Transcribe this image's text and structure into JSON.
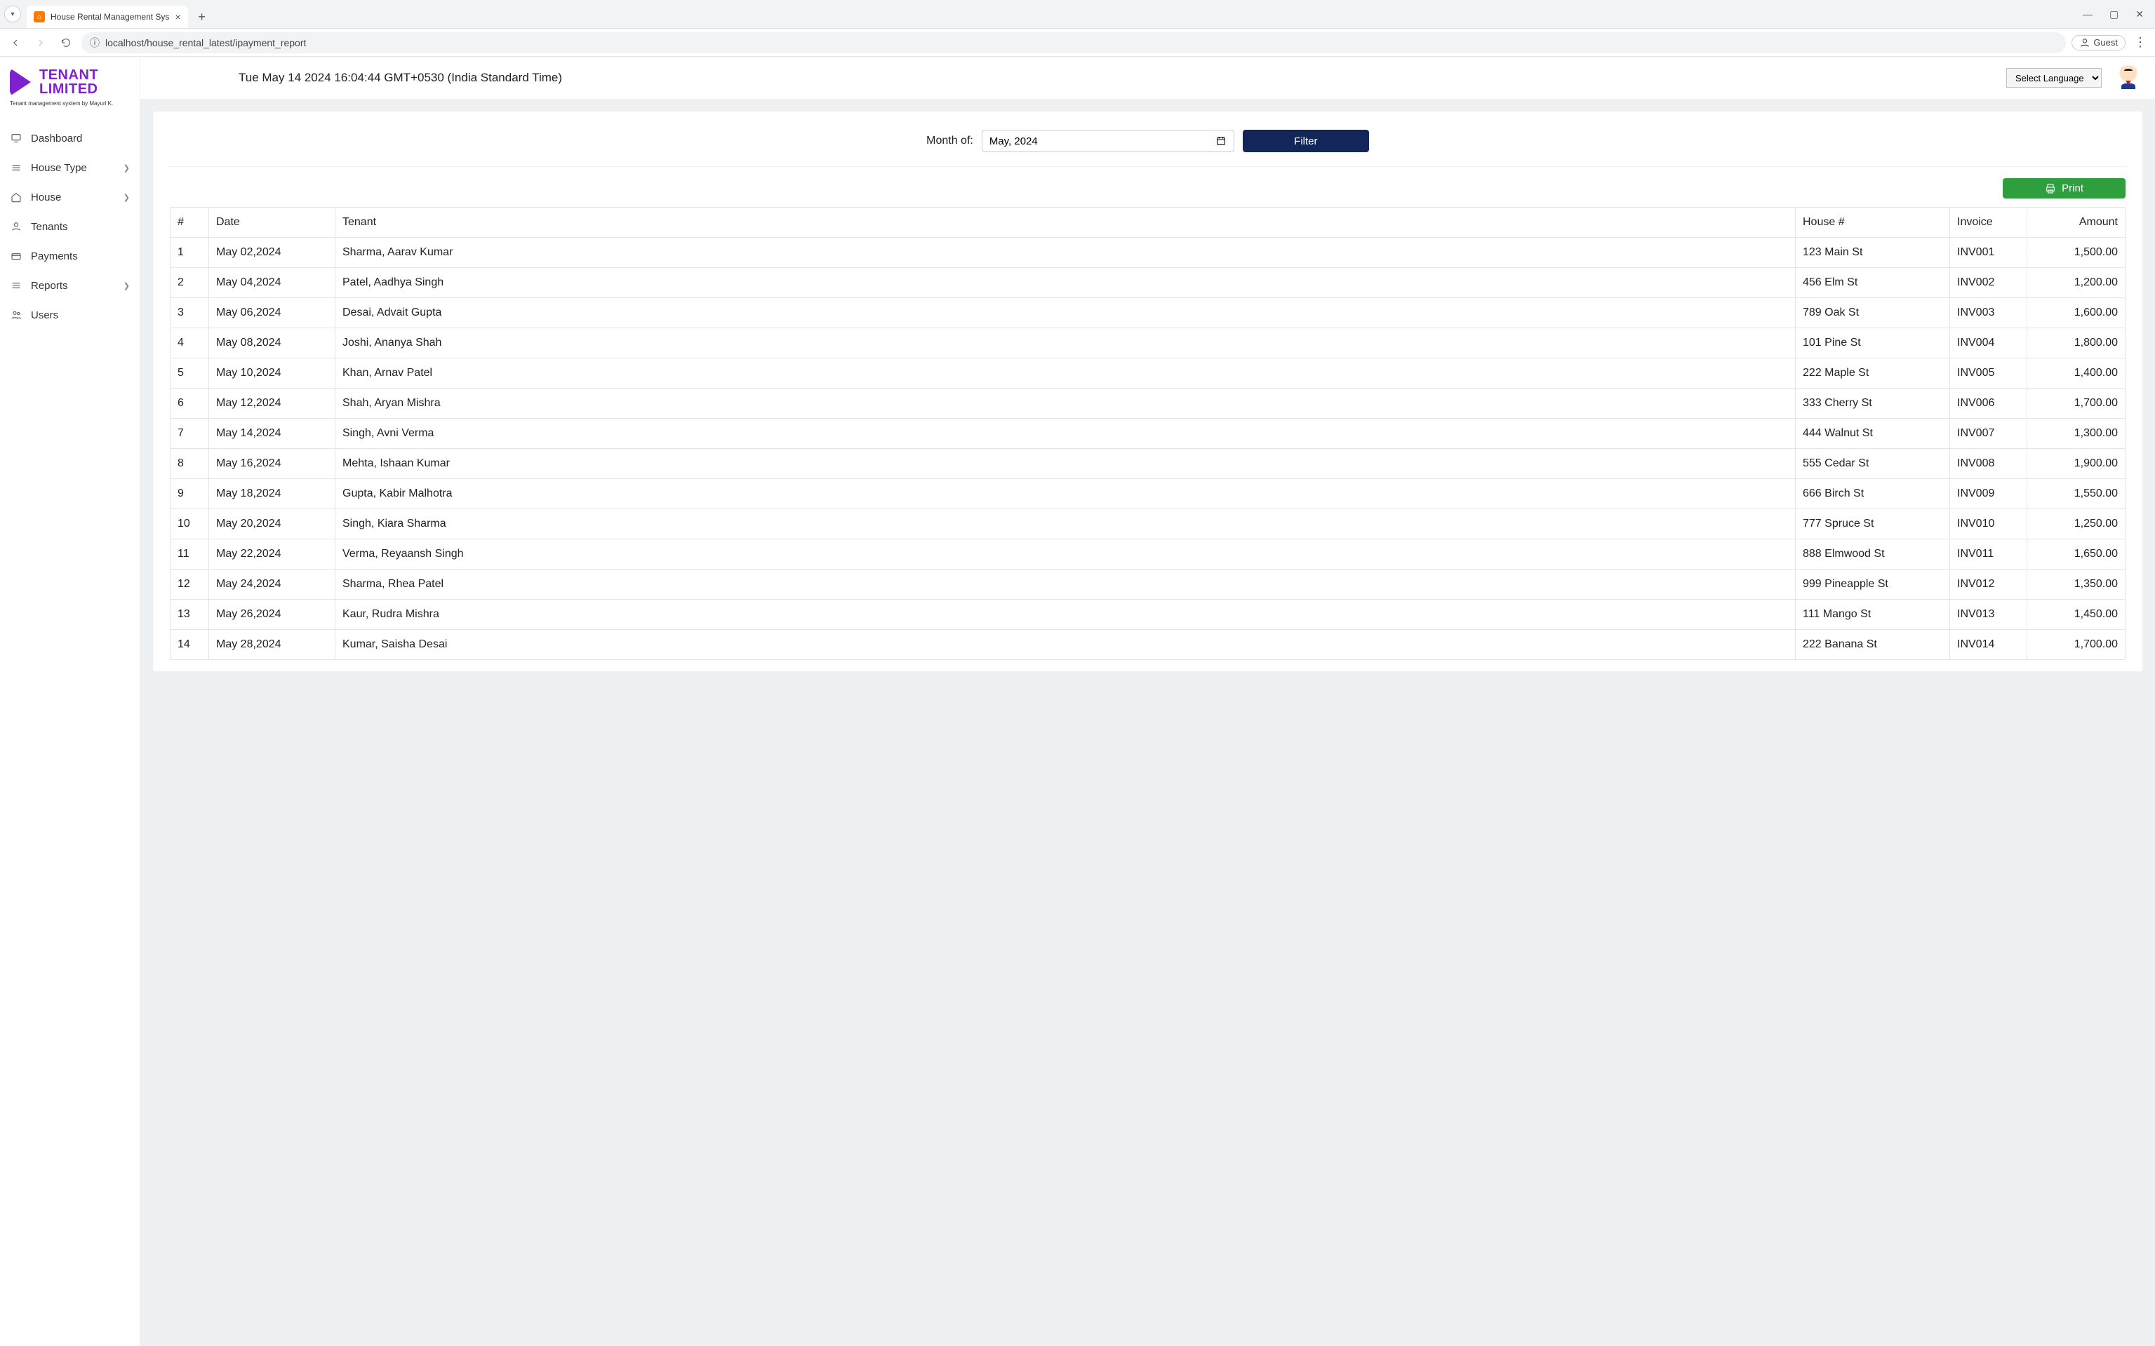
{
  "browser": {
    "tab_title": "House Rental Management Sys",
    "url": "localhost/house_rental_latest/ipayment_report",
    "guest_label": "Guest"
  },
  "brand": {
    "line1": "TENANT",
    "line2": "LIMITED",
    "subtitle": "Tenant management system by Mayuri K."
  },
  "sidebar": {
    "items": [
      {
        "label": "Dashboard",
        "expandable": false
      },
      {
        "label": "House Type",
        "expandable": true
      },
      {
        "label": "House",
        "expandable": true
      },
      {
        "label": "Tenants",
        "expandable": false
      },
      {
        "label": "Payments",
        "expandable": false
      },
      {
        "label": "Reports",
        "expandable": true
      },
      {
        "label": "Users",
        "expandable": false
      }
    ]
  },
  "topbar": {
    "timestamp": "Tue May 14 2024 16:04:44 GMT+0530 (India Standard Time)",
    "language_placeholder": "Select Language"
  },
  "filter": {
    "label": "Month of:",
    "month_value": "May, 2024",
    "button_label": "Filter"
  },
  "print_label": "Print",
  "table": {
    "headers": {
      "idx": "#",
      "date": "Date",
      "tenant": "Tenant",
      "house": "House #",
      "invoice": "Invoice",
      "amount": "Amount"
    },
    "rows": [
      {
        "idx": "1",
        "date": "May 02,2024",
        "tenant": "Sharma, Aarav Kumar",
        "house": "123 Main St",
        "invoice": "INV001",
        "amount": "1,500.00"
      },
      {
        "idx": "2",
        "date": "May 04,2024",
        "tenant": "Patel, Aadhya Singh",
        "house": "456 Elm St",
        "invoice": "INV002",
        "amount": "1,200.00"
      },
      {
        "idx": "3",
        "date": "May 06,2024",
        "tenant": "Desai, Advait Gupta",
        "house": "789 Oak St",
        "invoice": "INV003",
        "amount": "1,600.00"
      },
      {
        "idx": "4",
        "date": "May 08,2024",
        "tenant": "Joshi, Ananya Shah",
        "house": "101 Pine St",
        "invoice": "INV004",
        "amount": "1,800.00"
      },
      {
        "idx": "5",
        "date": "May 10,2024",
        "tenant": "Khan, Arnav Patel",
        "house": "222 Maple St",
        "invoice": "INV005",
        "amount": "1,400.00"
      },
      {
        "idx": "6",
        "date": "May 12,2024",
        "tenant": "Shah, Aryan Mishra",
        "house": "333 Cherry St",
        "invoice": "INV006",
        "amount": "1,700.00"
      },
      {
        "idx": "7",
        "date": "May 14,2024",
        "tenant": "Singh, Avni Verma",
        "house": "444 Walnut St",
        "invoice": "INV007",
        "amount": "1,300.00"
      },
      {
        "idx": "8",
        "date": "May 16,2024",
        "tenant": "Mehta, Ishaan Kumar",
        "house": "555 Cedar St",
        "invoice": "INV008",
        "amount": "1,900.00"
      },
      {
        "idx": "9",
        "date": "May 18,2024",
        "tenant": "Gupta, Kabir Malhotra",
        "house": "666 Birch St",
        "invoice": "INV009",
        "amount": "1,550.00"
      },
      {
        "idx": "10",
        "date": "May 20,2024",
        "tenant": "Singh, Kiara Sharma",
        "house": "777 Spruce St",
        "invoice": "INV010",
        "amount": "1,250.00"
      },
      {
        "idx": "11",
        "date": "May 22,2024",
        "tenant": "Verma, Reyaansh Singh",
        "house": "888 Elmwood St",
        "invoice": "INV011",
        "amount": "1,650.00"
      },
      {
        "idx": "12",
        "date": "May 24,2024",
        "tenant": "Sharma, Rhea Patel",
        "house": "999 Pineapple St",
        "invoice": "INV012",
        "amount": "1,350.00"
      },
      {
        "idx": "13",
        "date": "May 26,2024",
        "tenant": "Kaur, Rudra Mishra",
        "house": "111 Mango St",
        "invoice": "INV013",
        "amount": "1,450.00"
      },
      {
        "idx": "14",
        "date": "May 28,2024",
        "tenant": "Kumar, Saisha Desai",
        "house": "222 Banana St",
        "invoice": "INV014",
        "amount": "1,700.00"
      }
    ]
  }
}
